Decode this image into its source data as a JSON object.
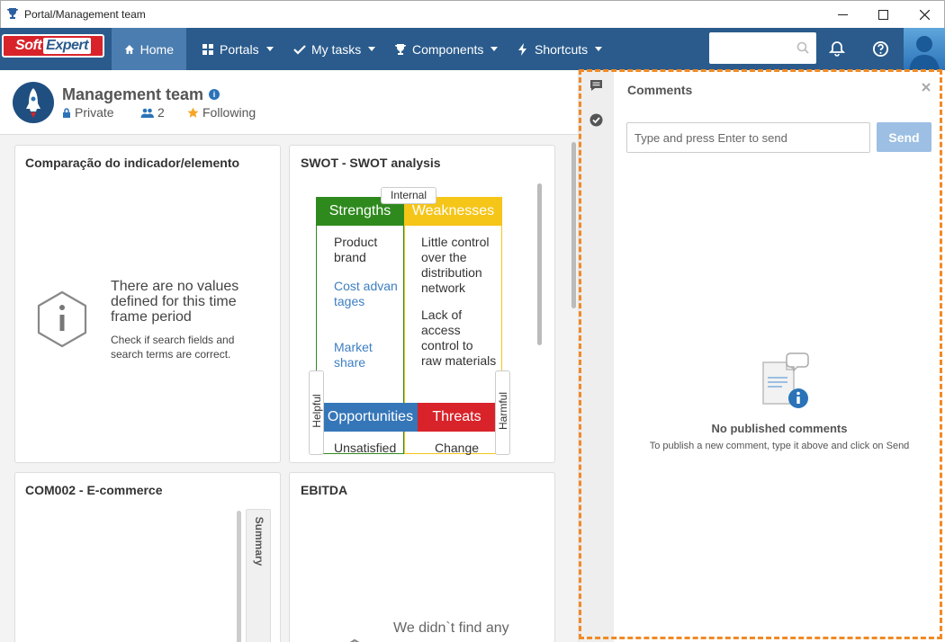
{
  "window": {
    "title": "Portal/Management team"
  },
  "nav": {
    "logo_soft": "Soft",
    "logo_expert": "Expert",
    "items": [
      {
        "label": "Home"
      },
      {
        "label": "Portals"
      },
      {
        "label": "My tasks"
      },
      {
        "label": "Components"
      },
      {
        "label": "Shortcuts"
      }
    ]
  },
  "header": {
    "title": "Management team",
    "privacy": "Private",
    "members": "2",
    "following": "Following"
  },
  "cards": {
    "indicator": {
      "title": "Comparação do indicador/elemento",
      "empty_title": "There are no values defined for this time frame period",
      "empty_sub": "Check if search fields and search terms are correct."
    },
    "swot": {
      "title": "SWOT - SWOT analysis",
      "internal": "Internal",
      "helpful": "Helpful",
      "harmful": "Harmful",
      "strengths": "Strengths",
      "weaknesses": "Weaknesses",
      "opportunities": "Opportunities",
      "threats": "Threats",
      "s_items": [
        "Product brand",
        "Cost advantages",
        "Market share"
      ],
      "w_items": [
        "Little control over the distribution network",
        "Lack of access control to raw materials"
      ],
      "o_items": [
        "Unsatisfied"
      ],
      "t_items": [
        "Change"
      ]
    },
    "ecommerce": {
      "title": "COM002 - E-commerce",
      "summary_tab": "Summary"
    },
    "ebitda": {
      "title": "EBITDA",
      "empty_title": "We didn`t find any"
    }
  },
  "comments": {
    "title": "Comments",
    "input_placeholder": "Type and press Enter to send",
    "send_label": "Send",
    "empty_title": "No published comments",
    "empty_sub": "To publish a new comment, type it above and click on Send"
  },
  "colors": {
    "navbar": "#2a5b8c",
    "strengths": "#2f8a1e",
    "weaknesses": "#f5c518",
    "opportunities": "#3576b8",
    "threats": "#d9232a",
    "highlight": "#f08a24"
  }
}
